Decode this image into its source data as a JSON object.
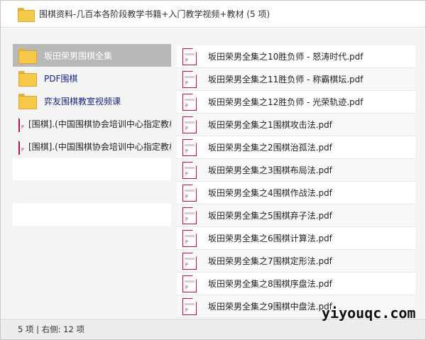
{
  "window": {
    "title": "围棋资料-几百本各阶段教学书籍+入门教学视频+教材 (5 项)"
  },
  "left_pane": {
    "items": [
      {
        "type": "folder",
        "label": "坂田荣男围棋全集",
        "selected": true
      },
      {
        "type": "folder",
        "label": "PDF围棋",
        "selected": false
      },
      {
        "type": "folder",
        "label": "弈友围棋教室视频课",
        "selected": false
      },
      {
        "type": "pdf",
        "label": "[围棋].(中国围棋协会培训中心指定教材",
        "selected": false
      },
      {
        "type": "pdf",
        "label": "[围棋].(中国围棋协会培训中心指定教材",
        "selected": false
      }
    ]
  },
  "right_pane": {
    "items": [
      {
        "type": "pdf",
        "label": "坂田荣男全集之10胜负师 - 怒涛时代.pdf"
      },
      {
        "type": "pdf",
        "label": "坂田荣男全集之11胜负师 - 称霸棋坛.pdf"
      },
      {
        "type": "pdf",
        "label": "坂田荣男全集之12胜负师 - 光荣轨迹.pdf"
      },
      {
        "type": "pdf",
        "label": "坂田荣男全集之1围棋攻击法.pdf"
      },
      {
        "type": "pdf",
        "label": "坂田荣男全集之2围棋治孤法.pdf"
      },
      {
        "type": "pdf",
        "label": "坂田荣男全集之3围棋布局法.pdf"
      },
      {
        "type": "pdf",
        "label": "坂田荣男全集之4围棋作战法.pdf"
      },
      {
        "type": "pdf",
        "label": "坂田荣男全集之5围棋弃子法.pdf"
      },
      {
        "type": "pdf",
        "label": "坂田荣男全集之6围棋计算法.pdf"
      },
      {
        "type": "pdf",
        "label": "坂田荣男全集之7围棋定形法.pdf"
      },
      {
        "type": "pdf",
        "label": "坂田荣男全集之8围棋序盘法.pdf"
      },
      {
        "type": "pdf",
        "label": "坂田荣男全集之9围棋中盘法.pdf"
      }
    ]
  },
  "statusbar": {
    "text": "5 项 | 右侧: 12 项"
  },
  "watermark": {
    "text": "yiyouqc.com"
  },
  "icons": {
    "folder": "folder-icon",
    "pdf": "pdf-file-icon",
    "pdf_mark": "P"
  },
  "colors": {
    "selected_row": "#b8b8b8",
    "folder_fill": "#f5c94b",
    "pdf_border": "#b0173a",
    "link_text": "#1a237e"
  }
}
